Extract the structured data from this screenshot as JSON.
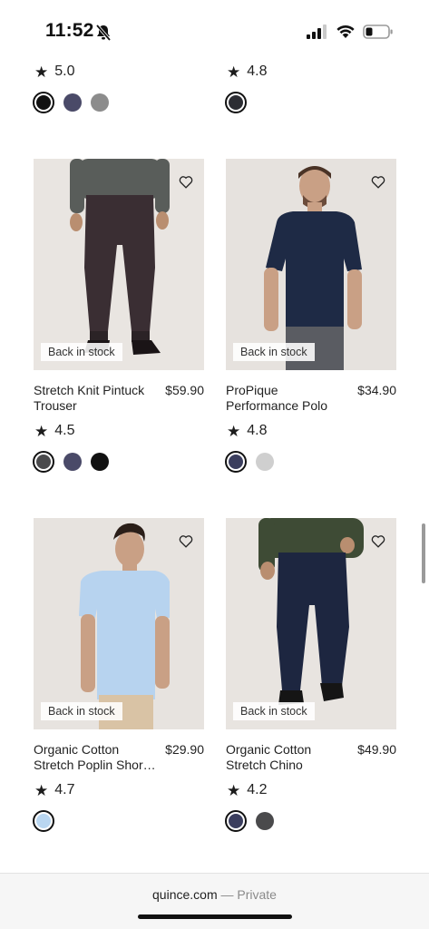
{
  "status_bar": {
    "time": "11:52"
  },
  "top_row": [
    {
      "rating": "5.0",
      "swatches": [
        "#111111",
        "#4a4a68",
        "#8c8c8c"
      ],
      "selected": 0
    },
    {
      "rating": "4.8",
      "swatches": [
        "#2c2d33"
      ],
      "selected": 0
    }
  ],
  "products": [
    {
      "name": "Stretch Knit Pintuck Trouser",
      "price": "$59.90",
      "badge": "Back in stock",
      "rating": "4.5",
      "swatches": [
        "#4a4a4c",
        "#4a4a68",
        "#111111"
      ],
      "selected": 0
    },
    {
      "name": "ProPique Performance Polo",
      "price": "$34.90",
      "badge": "Back in stock",
      "rating": "4.8",
      "swatches": [
        "#3b3e5e",
        "#cfcfcf"
      ],
      "selected": 0
    },
    {
      "name": "Organic Cotton Stretch Poplin Shor…",
      "price": "$29.90",
      "badge": "Back in stock",
      "rating": "4.7",
      "swatches": [
        "#b9d6f0"
      ],
      "selected": 0
    },
    {
      "name": "Organic Cotton Stretch Chino",
      "price": "$49.90",
      "badge": "Back in stock",
      "rating": "4.2",
      "swatches": [
        "#3b3e5e",
        "#4a4a4c"
      ],
      "selected": 0
    }
  ],
  "address_bar": {
    "domain": "quince.com",
    "separator": " — ",
    "mode": "Private"
  }
}
